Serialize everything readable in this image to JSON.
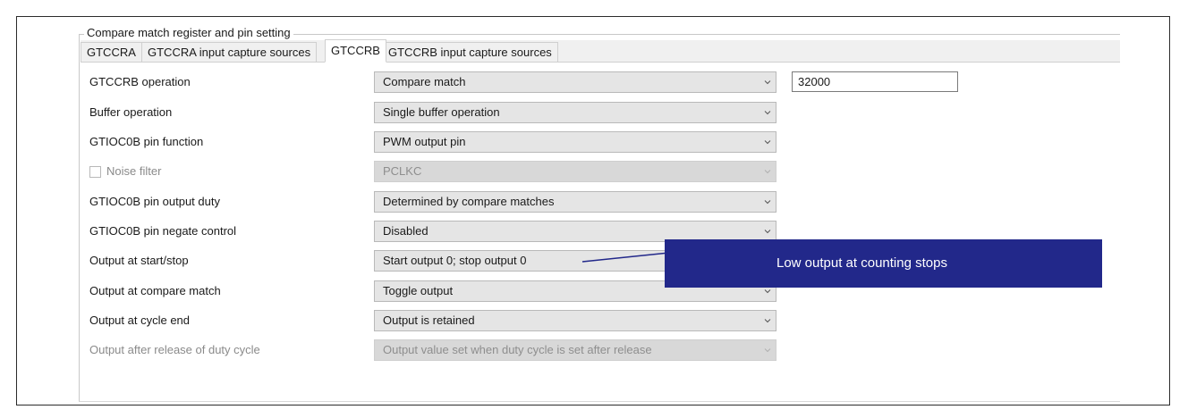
{
  "group": {
    "title": "Compare match register and pin setting"
  },
  "tabs": [
    {
      "label": "GTCCRA",
      "active": false
    },
    {
      "label": "GTCCRA input capture sources",
      "active": false
    },
    {
      "label": "GTCCRB",
      "active": true
    },
    {
      "label": "GTCCRB input capture sources",
      "active": false
    }
  ],
  "rows": [
    {
      "label": "GTCCRB operation",
      "value": "Compare match",
      "enabled": true
    },
    {
      "label": "Buffer operation",
      "value": "Single buffer operation",
      "enabled": true
    },
    {
      "label": "GTIOC0B pin function",
      "value": "PWM output pin",
      "enabled": true
    },
    {
      "label": "Noise filter",
      "value": "PCLKC",
      "enabled": false,
      "has_checkbox": true,
      "checked": false
    },
    {
      "label": "GTIOC0B pin output duty",
      "value": "Determined by compare matches",
      "enabled": true
    },
    {
      "label": "GTIOC0B pin negate control",
      "value": "Disabled",
      "enabled": true
    },
    {
      "label": "Output at start/stop",
      "value": "Start output 0; stop output 0",
      "enabled": true
    },
    {
      "label": "Output at compare match",
      "value": "Toggle output",
      "enabled": true
    },
    {
      "label": "Output at cycle end",
      "value": "Output is retained",
      "enabled": true
    },
    {
      "label": "Output after release of duty cycle",
      "value": "Output value set when duty cycle is set after release",
      "enabled": false
    }
  ],
  "compare_value": {
    "value": "32000"
  },
  "callout": {
    "text": "Low output at counting stops",
    "color": "#22288a"
  },
  "icons": {
    "dropdown": "chevron-down-icon"
  }
}
